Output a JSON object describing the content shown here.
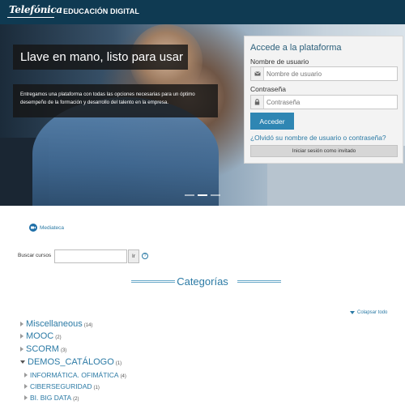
{
  "header": {
    "brand": "Telefónica",
    "subtitle": "EDUCACIÓN DIGITAL"
  },
  "hero": {
    "title": "Llave en mano, listo para usar",
    "description": "Entregamos una plataforma con todas las opciones necesarias para un óptimo desempeño de la formación y desarrollo del talento en la empresa."
  },
  "login": {
    "title": "Accede a la plataforma",
    "username_label": "Nombre de usuario",
    "username_placeholder": "Nombre de usuario",
    "password_label": "Contraseña",
    "password_placeholder": "Contraseña",
    "submit": "Acceder",
    "forgot": "¿Olvidó su nombre de usuario o contraseña?",
    "guest": "Iniciar sesión como invitado"
  },
  "media": {
    "label": "Mediateca"
  },
  "search": {
    "label": "Buscar cursos",
    "button": "Ir",
    "help": "?"
  },
  "categories": {
    "title": "Categorías",
    "collapse_all": "Colapsar todo",
    "items": [
      {
        "name": "Miscellaneous",
        "count": "(14)"
      },
      {
        "name": "MOOC",
        "count": "(2)"
      },
      {
        "name": "SCORM",
        "count": "(3)"
      },
      {
        "name": "DEMOS_CATÁLOGO",
        "count": "(1)"
      }
    ],
    "subitems": [
      {
        "name": "INFORMÁTICA. OFIMÁTICA",
        "count": "(4)"
      },
      {
        "name": "CIBERSEGURIDAD",
        "count": "(1)"
      },
      {
        "name": "BI. BIG DATA",
        "count": "(2)"
      }
    ]
  },
  "colors": {
    "header_bg": "#0f3a52",
    "accent": "#2b7aa5",
    "button": "#2f86b3"
  },
  "icons": [
    "envelope-icon",
    "lock-icon",
    "media-icon",
    "help-icon"
  ]
}
